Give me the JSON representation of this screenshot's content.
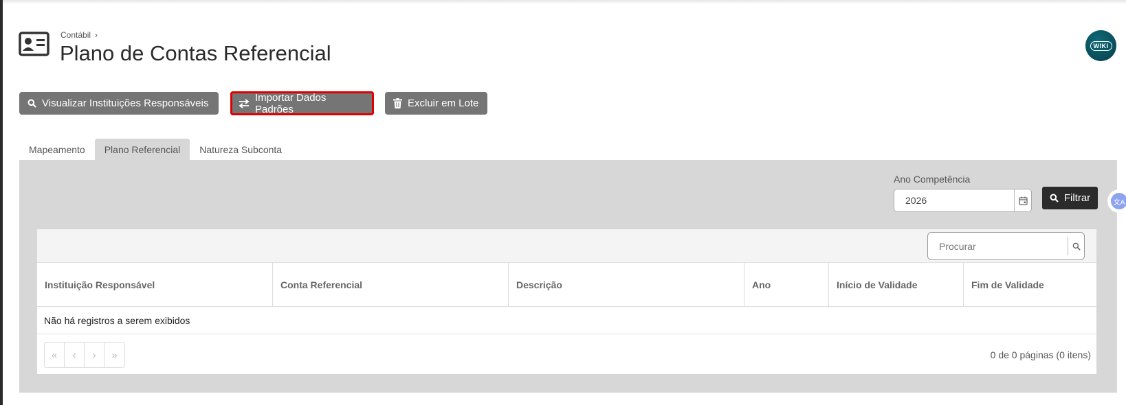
{
  "breadcrumb": {
    "parent": "Contábil"
  },
  "page": {
    "title": "Plano de Contas Referencial",
    "wiki_label": "WIKI"
  },
  "toolbar": {
    "visualizar_label": "Visualizar Instituições Responsáveis",
    "importar_label": "Importar Dados Padrões",
    "excluir_label": "Excluir em Lote"
  },
  "tabs": [
    {
      "label": "Mapeamento",
      "active": false
    },
    {
      "label": "Plano Referencial",
      "active": true
    },
    {
      "label": "Natureza Subconta",
      "active": false
    }
  ],
  "filter": {
    "ano_label": "Ano Competência",
    "ano_value": "2026",
    "filtrar_label": "Filtrar"
  },
  "grid": {
    "search_placeholder": "Procurar",
    "columns": [
      "Instituição Responsável",
      "Conta Referencial",
      "Descrição",
      "Ano",
      "Início de Validade",
      "Fim de Validade"
    ],
    "empty_message": "Não há registros a serem exibidos",
    "page_info": "0 de 0 páginas (0 itens)"
  },
  "colors": {
    "button_gray": "#757575",
    "highlight_red": "#e10000",
    "filter_dark": "#2b2b2b",
    "panel_gray": "#d7d7d7",
    "wiki_teal": "#0b5563"
  },
  "icons": {
    "page": "id-card-icon",
    "visualizar": "search-icon",
    "importar": "swap-arrows-icon",
    "excluir": "trash-icon",
    "calendar": "calendar-icon",
    "filtrar": "search-icon"
  }
}
